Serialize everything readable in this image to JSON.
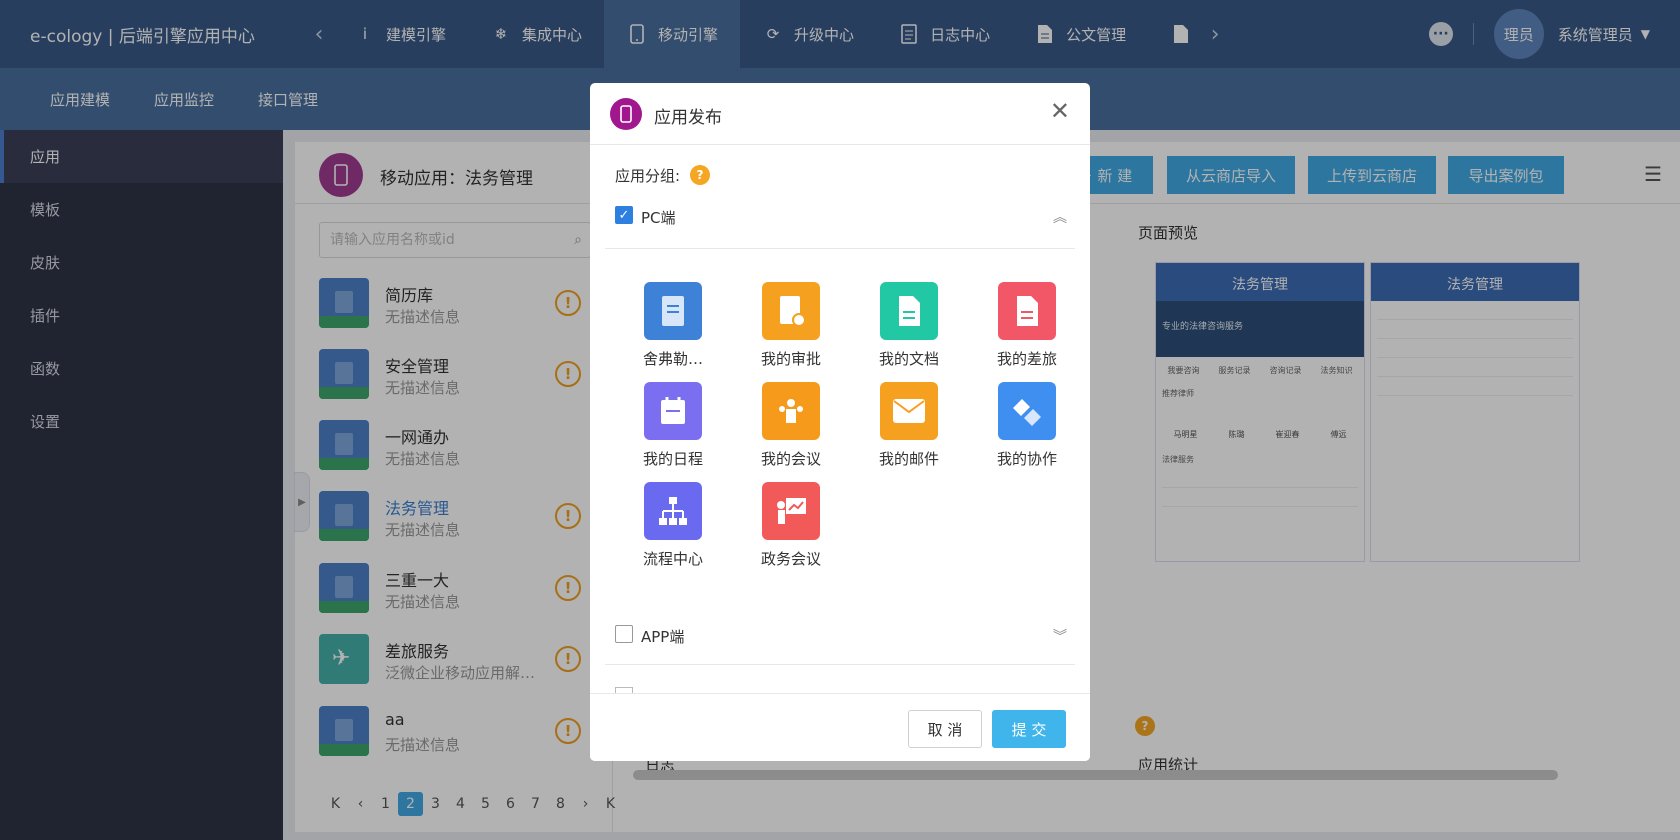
{
  "topbar": {
    "brand": "e-cology | 后端引擎应用中心",
    "nav": [
      {
        "label": "建模引擎",
        "icon": "cube-icon",
        "active": false
      },
      {
        "label": "集成中心",
        "icon": "snowflake-icon",
        "active": false
      },
      {
        "label": "移动引擎",
        "icon": "mobile-phone-icon",
        "active": true
      },
      {
        "label": "升级中心",
        "icon": "refresh-cycle-icon",
        "active": false
      },
      {
        "label": "日志中心",
        "icon": "log-document-icon",
        "active": false
      },
      {
        "label": "公文管理",
        "icon": "file-icon",
        "active": false
      }
    ],
    "avatar_text": "理员",
    "user_name": "系统管理员"
  },
  "subnav": [
    "应用建模",
    "应用监控",
    "接口管理"
  ],
  "sidebar": {
    "items": [
      {
        "label": "应用",
        "active": true
      },
      {
        "label": "模板",
        "active": false
      },
      {
        "label": "皮肤",
        "active": false
      },
      {
        "label": "插件",
        "active": false
      },
      {
        "label": "函数",
        "active": false
      },
      {
        "label": "设置",
        "active": false
      }
    ]
  },
  "panel": {
    "title": "移动应用：法务管理",
    "buttons": [
      "＋ 新 建",
      "从云商店导入",
      "上传到云商店",
      "导出案例包"
    ],
    "search_placeholder": "请输入应用名称或id",
    "preview_title": "页面预览",
    "log_label": "日志",
    "stats_label": "应用统计"
  },
  "apps": [
    {
      "name": "简历库",
      "desc": "无描述信息",
      "selected": false
    },
    {
      "name": "安全管理",
      "desc": "无描述信息",
      "selected": false
    },
    {
      "name": "一网通办",
      "desc": "无描述信息",
      "selected": false
    },
    {
      "name": "法务管理",
      "desc": "无描述信息",
      "selected": true
    },
    {
      "name": "三重一大",
      "desc": "无描述信息",
      "selected": false
    },
    {
      "name": "差旅服务",
      "desc": "泛微企业移动应用解决方案",
      "selected": false
    },
    {
      "name": "aa",
      "desc": "无描述信息",
      "selected": false
    }
  ],
  "pager": {
    "pages": [
      "1",
      "2",
      "3",
      "4",
      "5",
      "6",
      "7",
      "8"
    ],
    "current": "2"
  },
  "preview": {
    "phone_title": "法务管理",
    "banner_text": "专业的法律咨询服务",
    "tabs": [
      "我要咨询",
      "服务记录",
      "咨询记录",
      "法务知识"
    ],
    "section_lawyers": "推荐律师",
    "lawyers": [
      "马明星",
      "陈璐",
      "崔迎春",
      "傅远"
    ],
    "section_services": "法律服务"
  },
  "modal": {
    "title": "应用发布",
    "group_label": "应用分组:",
    "pc_label": "PC端",
    "app_label": "APP端",
    "cancel": "取 消",
    "submit": "提 交",
    "tiles": [
      {
        "label": "舍弗勒…",
        "color": "#3d82d6",
        "icon": "document-icon"
      },
      {
        "label": "我的审批",
        "color": "#f5a01f",
        "icon": "approval-clock-icon"
      },
      {
        "label": "我的文档",
        "color": "#22c7a4",
        "icon": "doc-icon"
      },
      {
        "label": "我的差旅",
        "color": "#f25767",
        "icon": "travel-doc-icon"
      },
      {
        "label": "我的日程",
        "color": "#7b6ef0",
        "icon": "calendar-icon"
      },
      {
        "label": "我的会议",
        "color": "#f59a1a",
        "icon": "meeting-people-icon"
      },
      {
        "label": "我的邮件",
        "color": "#f5a01f",
        "icon": "mail-icon"
      },
      {
        "label": "我的协作",
        "color": "#3f8ff0",
        "icon": "handshake-icon"
      },
      {
        "label": "流程中心",
        "color": "#6a6af0",
        "icon": "org-chart-icon"
      },
      {
        "label": "政务会议",
        "color": "#f25a5a",
        "icon": "presentation-icon"
      }
    ]
  }
}
